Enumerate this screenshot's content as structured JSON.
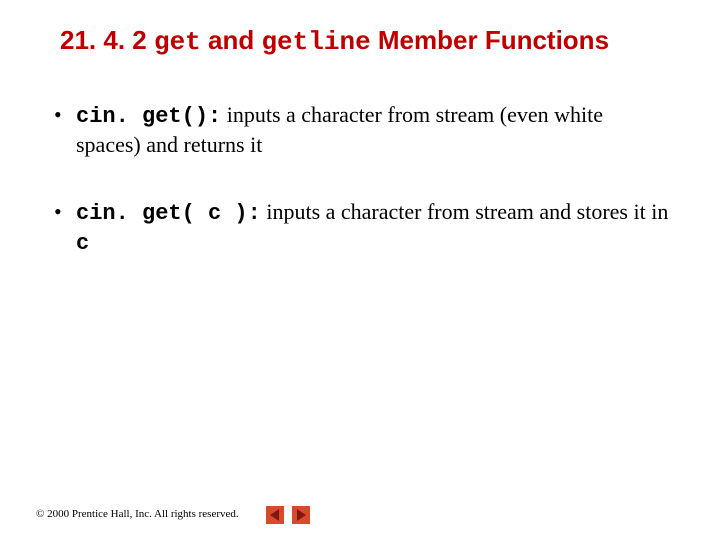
{
  "title": {
    "section_no": "21. 4. 2",
    "code1": "get",
    "mid": " and ",
    "code2": "getline",
    "rest": " Member Functions"
  },
  "bullets": [
    {
      "code": "cin. get():",
      "text": " inputs a character from stream (even white spaces) and returns it"
    },
    {
      "code": "cin. get( c ):",
      "text_before": " inputs a character from stream and stores it in ",
      "code2": "c"
    }
  ],
  "footer": "© 2000 Prentice Hall, Inc. All rights reserved.",
  "icons": {
    "prev": "prev-triangle",
    "next": "next-triangle"
  }
}
